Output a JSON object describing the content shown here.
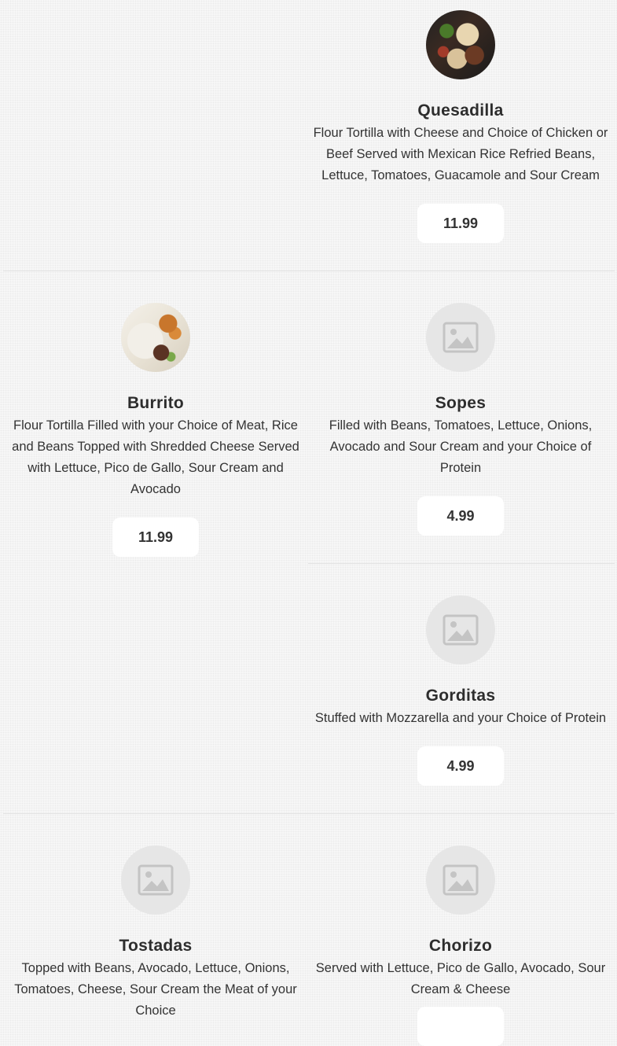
{
  "menu": {
    "items": [
      {
        "name": "Quesadilla",
        "description": "Flour Tortilla with Cheese and Choice of Chicken or Beef Served with Mexican Rice Refried Beans, Lettuce, Tomatoes, Guacamole and Sour Cream",
        "price": "11.99",
        "image": "quesadilla-photo"
      },
      {
        "name": "Burrito",
        "description": "Flour Tortilla Filled with your Choice of Meat, Rice and Beans Topped with Shredded Cheese Served with Lettuce, Pico de Gallo, Sour Cream and Avocado",
        "price": "11.99",
        "image": "burrito-photo"
      },
      {
        "name": "Sopes",
        "description": "Filled with Beans, Tomatoes, Lettuce, Onions, Avocado and Sour Cream and your Choice of Protein",
        "price": "4.99",
        "image": "image-placeholder-icon"
      },
      {
        "name": "Gorditas",
        "description": "Stuffed with Mozzarella and your Choice of Protein",
        "price": "4.99",
        "image": "image-placeholder-icon"
      },
      {
        "name": "Tostadas",
        "description": "Topped with Beans, Avocado, Lettuce, Onions, Tomatoes, Cheese, Sour Cream the Meat of your Choice",
        "price": "",
        "image": "image-placeholder-icon"
      },
      {
        "name": "Chorizo",
        "description": "Served with Lettuce, Pico de Gallo, Avocado, Sour Cream & Cheese",
        "price": "",
        "image": "image-placeholder-icon"
      }
    ]
  },
  "colors": {
    "background": "#f7f7f7",
    "card": "#ffffff",
    "placeholder": "#e6e6e6",
    "text": "#2d2d2d",
    "divider": "#e4e4e4"
  }
}
